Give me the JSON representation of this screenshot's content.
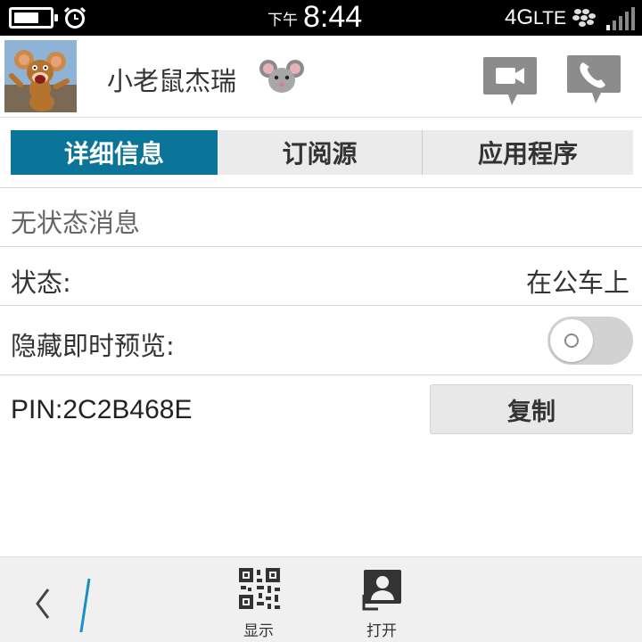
{
  "status_bar": {
    "battery_level": 0.7,
    "alarm_icon": "alarm-clock-icon",
    "ampm": "下午",
    "time": "8:44",
    "network": "4G",
    "network_type": "LTE",
    "bb_icon": "blackberry-icon",
    "signal_icon": "signal-bars-icon"
  },
  "header": {
    "avatar_icon": "jerry-mouse-avatar",
    "name": "小老鼠杰瑞",
    "emoji_icon": "mouse-face-icon",
    "video_icon": "video-call-icon",
    "call_icon": "phone-call-icon"
  },
  "tabs": [
    {
      "label": "详细信息",
      "active": true
    },
    {
      "label": "订阅源",
      "active": false
    },
    {
      "label": "应用程序",
      "active": false
    }
  ],
  "details": {
    "status_message": "无状态消息",
    "status_label": "状态:",
    "status_value": "在公车上",
    "hide_preview_label": "隐藏即时预览:",
    "hide_preview_on": false,
    "pin": "PIN:2C2B468E",
    "copy_label": "复制"
  },
  "action_bar": {
    "back_icon": "back-chevron-icon",
    "show_label": "显示",
    "show_icon": "qr-code-icon",
    "open_label": "打开",
    "open_icon": "contact-card-icon"
  },
  "colors": {
    "accent": "#0b7599",
    "status_bar_bg": "#000000",
    "action_bar_bg": "#f0f0f0",
    "toggle_off": "#d2d2d2"
  }
}
